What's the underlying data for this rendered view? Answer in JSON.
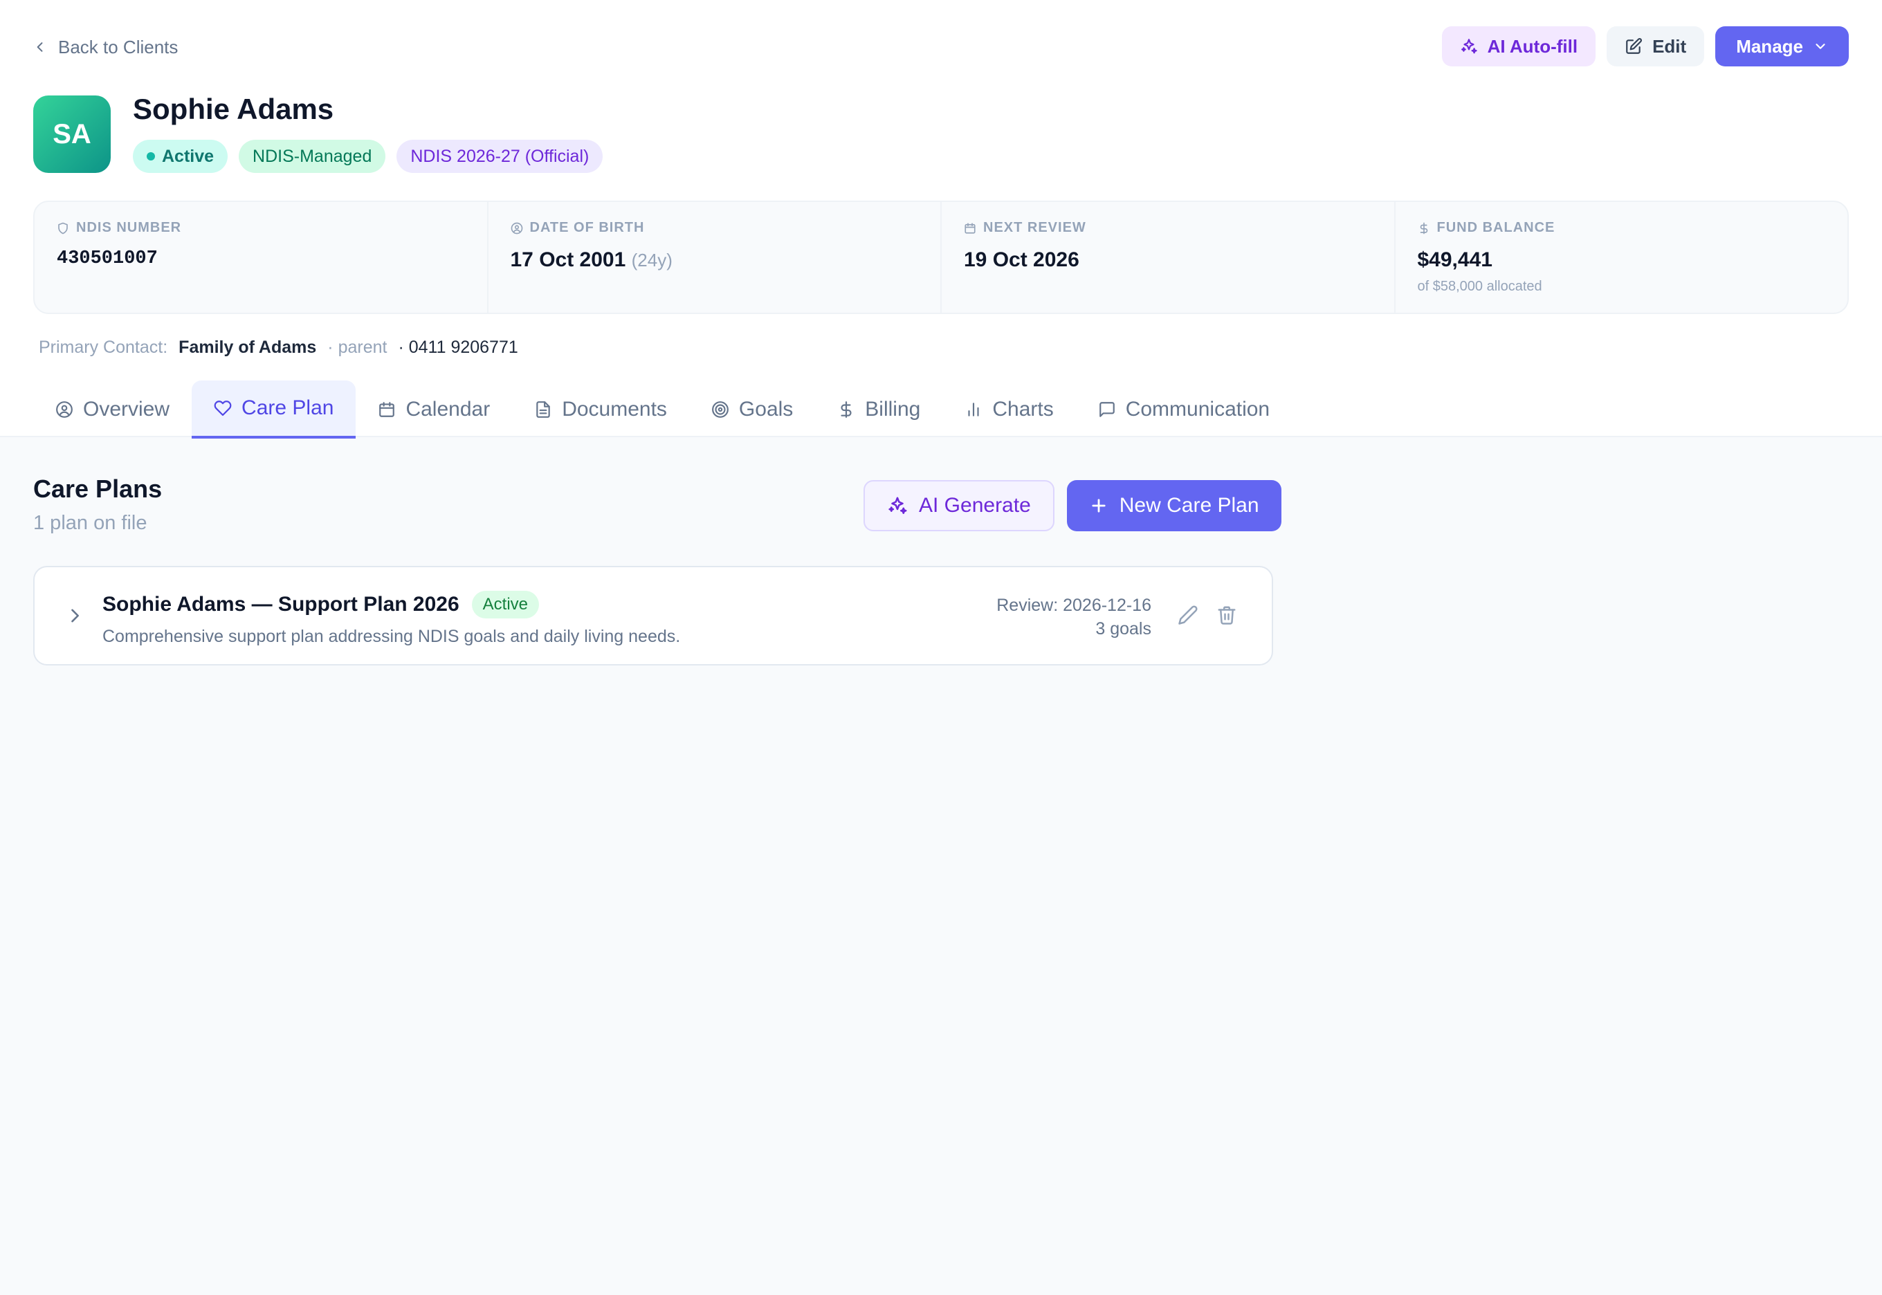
{
  "nav": {
    "back_label": "Back to Clients"
  },
  "actions": {
    "ai_autofill": "AI Auto-fill",
    "edit": "Edit",
    "manage": "Manage"
  },
  "client": {
    "initials": "SA",
    "name": "Sophie Adams",
    "badges": {
      "status": "Active",
      "funding": "NDIS-Managed",
      "plan": "NDIS 2026-27 (Official)"
    }
  },
  "info": {
    "ndis": {
      "label": "NDIS NUMBER",
      "value": "430501007"
    },
    "dob": {
      "label": "DATE OF BIRTH",
      "value": "17 Oct 2001",
      "age": "(24y)"
    },
    "review": {
      "label": "NEXT REVIEW",
      "value": "19 Oct 2026"
    },
    "fund": {
      "label": "FUND BALANCE",
      "value": "$49,441",
      "sub": "of $58,000 allocated"
    }
  },
  "contact": {
    "label": "Primary Contact:",
    "name": "Family of Adams",
    "relation": "· parent",
    "phone": "· 0411 9206771"
  },
  "tabs": [
    {
      "label": "Overview",
      "icon": "user-circle-icon"
    },
    {
      "label": "Care Plan",
      "icon": "heart-icon"
    },
    {
      "label": "Calendar",
      "icon": "calendar-icon"
    },
    {
      "label": "Documents",
      "icon": "document-icon"
    },
    {
      "label": "Goals",
      "icon": "target-icon"
    },
    {
      "label": "Billing",
      "icon": "dollar-icon"
    },
    {
      "label": "Charts",
      "icon": "bar-chart-icon"
    },
    {
      "label": "Communication",
      "icon": "message-icon"
    }
  ],
  "active_tab": "Care Plan",
  "care_plans": {
    "title": "Care Plans",
    "subtitle": "1 plan on file",
    "ai_generate": "AI Generate",
    "new_plan": "New Care Plan",
    "items": [
      {
        "name": "Sophie Adams — Support Plan 2026",
        "status": "Active",
        "description": "Comprehensive support plan addressing NDIS goals and daily living needs.",
        "review": "Review: 2026-12-16",
        "goals": "3 goals"
      }
    ]
  },
  "colors": {
    "accent": "#6366f1",
    "ai_purple": "#6d28d9",
    "active_teal": "#14b8a6",
    "avatar_gradient_start": "#34d399",
    "avatar_gradient_end": "#0d9488"
  }
}
